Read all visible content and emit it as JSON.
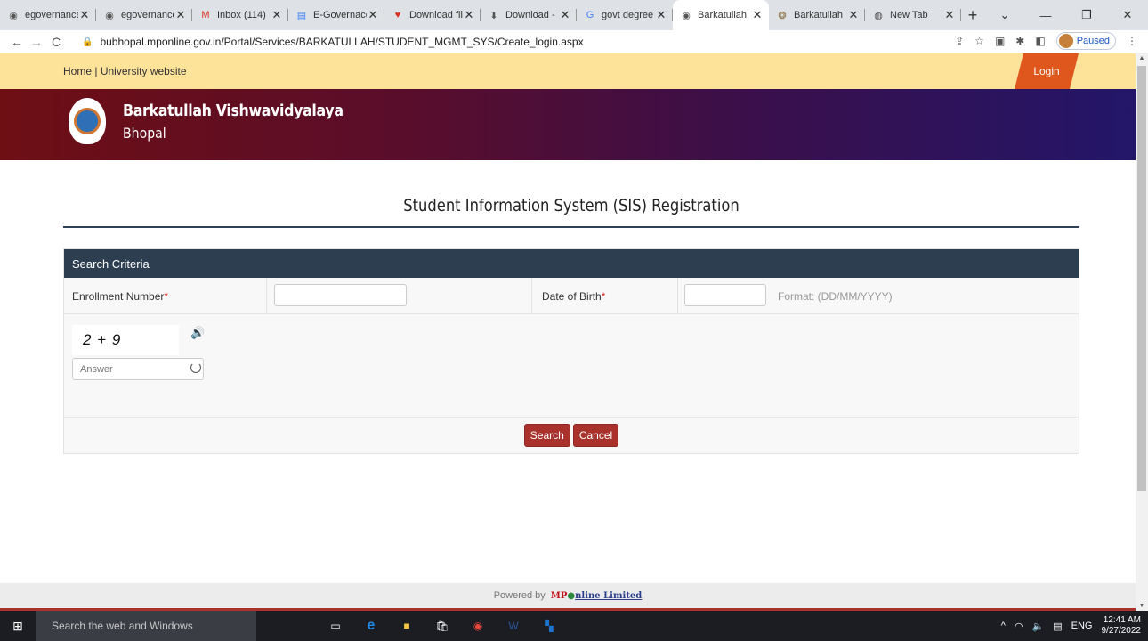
{
  "browser": {
    "tabs": [
      {
        "title": "egovernance",
        "icon": "globe-icon",
        "active": false
      },
      {
        "title": "egovernance",
        "icon": "globe-icon",
        "active": false
      },
      {
        "title": "Inbox (114)",
        "icon": "gmail-icon",
        "active": false
      },
      {
        "title": "E-Governace",
        "icon": "docs-icon",
        "active": false
      },
      {
        "title": "Download fil",
        "icon": "heart-icon",
        "active": false
      },
      {
        "title": "Download -",
        "icon": "download-site-icon",
        "active": false
      },
      {
        "title": "govt degree",
        "icon": "google-icon",
        "active": false
      },
      {
        "title": "Barkatullah",
        "icon": "globe-icon",
        "active": true
      },
      {
        "title": "Barkatullah",
        "icon": "university-icon",
        "active": false
      },
      {
        "title": "New Tab",
        "icon": "chrome-icon",
        "active": false
      }
    ],
    "url": "bubhopal.mponline.gov.in/Portal/Services/BARKATULLAH/STUDENT_MGMT_SYS/Create_login.aspx",
    "profile_status": "Paused"
  },
  "page": {
    "topnav": {
      "home": "Home",
      "separator": " | ",
      "university": "University website",
      "login": "Login"
    },
    "banner": {
      "name": "Barkatullah Vishwavidyalaya",
      "city": "Bhopal"
    },
    "heading": "Student Information System (SIS) Registration",
    "panel": {
      "title": "Search Criteria",
      "enrollment_label": "Enrollment Number",
      "dob_label": "Date of Birth",
      "required_mark": "*",
      "dob_format": "Format: (DD/MM/YYYY)",
      "captcha_text": "2 + 9",
      "answer_placeholder": "Answer",
      "search_button": "Search",
      "cancel_button": "Cancel"
    },
    "footer": {
      "powered_by": "Powered by",
      "brand_mp": "MP",
      "brand_online": "nline Limited"
    }
  },
  "taskbar": {
    "search_placeholder": "Search the web and Windows",
    "language": "ENG",
    "time": "12:41 AM",
    "date": "9/27/2022"
  }
}
